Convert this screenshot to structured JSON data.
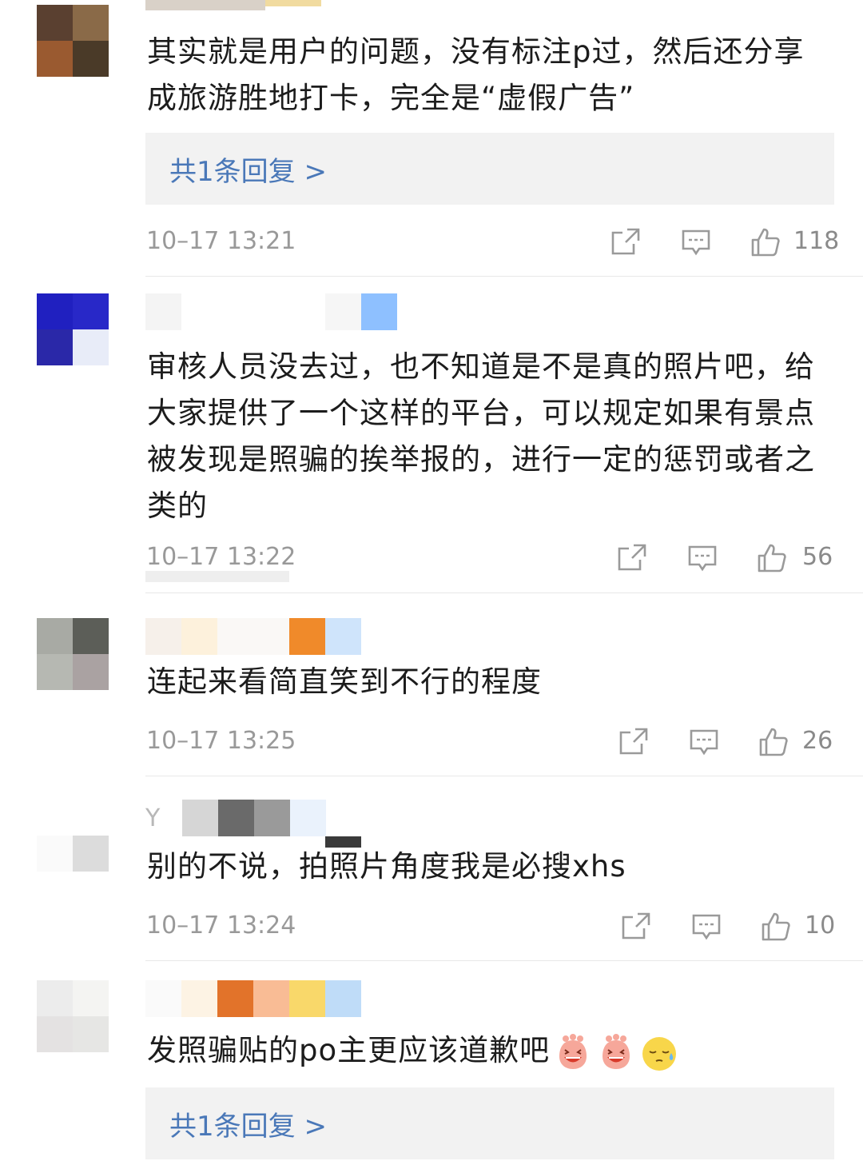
{
  "comments": [
    {
      "name": "",
      "text": "其实就是用户的问题，没有标注p过，然后还分享成旅游胜地打卡，完全是“虚假广告”",
      "replies": "共1条回复 >",
      "time": "10–17 13:21",
      "likes": "118"
    },
    {
      "name": "",
      "text": "审核人员没去过，也不知道是不是真的照片吧，给大家提供了一个这样的平台，可以规定如果有景点被发现是照骗的挨举报的，进行一定的惩罚或者之类的",
      "time": "10–17 13:22",
      "likes": "56"
    },
    {
      "name": "",
      "text": "连起来看简直笑到不行的程度",
      "time": "10–17 13:25",
      "likes": "26"
    },
    {
      "name": "Y",
      "text": "别的不说，拍照片角度我是必搜xhs",
      "time": "10–17 13:24",
      "likes": "10"
    },
    {
      "name": "",
      "text": "发照骗贴的po主更应该道歉吧",
      "emojis": [
        "laughing-face-icon",
        "laughing-face-icon",
        "sweat-face-icon"
      ],
      "replies": "共1条回复 >"
    }
  ],
  "icons": {
    "share": "share-icon",
    "comment": "comment-icon",
    "like": "thumbs-up-icon"
  },
  "colors": {
    "reply_link": "#4a78b8",
    "reply_bg": "#f2f2f2",
    "meta_text": "#999999"
  }
}
